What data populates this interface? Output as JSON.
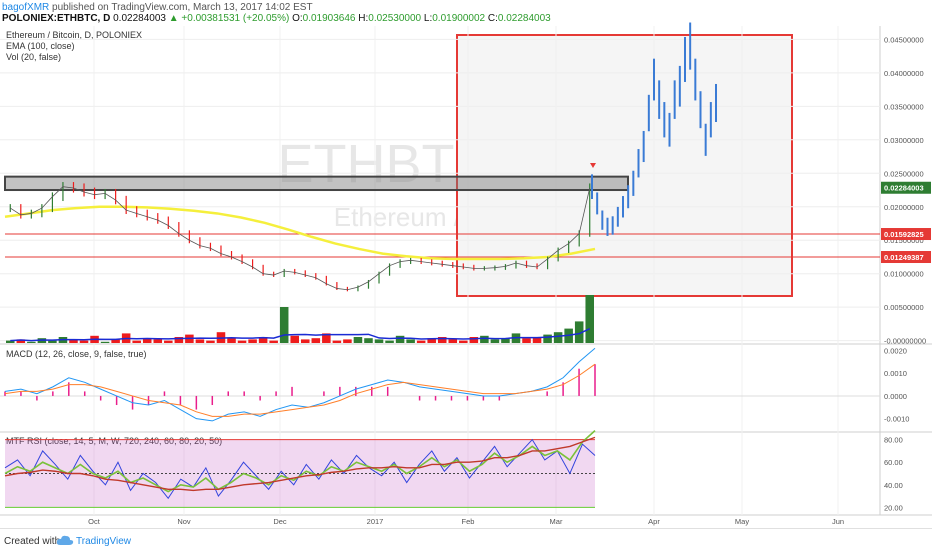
{
  "header": {
    "author": "bagofXMR",
    "published": " published on TradingView.com, March 13, 2017 14:02 EST",
    "symbol": "POLONIEX:ETHBTC, D",
    "price": "0.02284003",
    "change": "▲ +0.00381531 (+20.05%)",
    "o_label": "O:",
    "o": "0.01903646",
    "h_label": "H:",
    "h": "0.02530000",
    "l_label": "L:",
    "l": "0.01900002",
    "c_label": "C:",
    "c": "0.02284003"
  },
  "legend": {
    "series": "Ethereum / Bitcoin, D, POLONIEX",
    "ema": "EMA (100, close)",
    "vol": "Vol (20, false)",
    "macd": "MACD (12, 26, close, 9, false, true)",
    "rsi": "MTF RSI (close, 14, 5, M, W, 720, 240, 60, 80, 20, 50)"
  },
  "watermark": {
    "symbol": "ETHBTC, D",
    "name": "Ethereum / Bitcoin"
  },
  "footer": {
    "created_with": "Created with",
    "brand": "TradingView"
  },
  "colors": {
    "up": "#2e7d32",
    "down": "#ee1c1c",
    "ema": "#f5ef3c",
    "vol_ma": "#1a2bd4",
    "line_red": "#e53935",
    "projection": "#3a7bd5",
    "zone": "#444444"
  },
  "chart_data": [
    {
      "type": "line",
      "title": "Ethereum / Bitcoin, D, POLONIEX",
      "ylim": [
        -0.0005,
        0.047
      ],
      "y_ticks": [
        "0.04500000",
        "0.04000000",
        "0.03500000",
        "0.03000000",
        "0.02500000",
        "0.02000000",
        "0.01500000",
        "0.01000000",
        "0.00500000",
        "-0.00000000"
      ],
      "x_ticks": [
        "Oct",
        "Nov",
        "Dec",
        "2017",
        "Feb",
        "Mar",
        "Apr",
        "May",
        "Jun"
      ],
      "price_labels": [
        {
          "text": "0.02284003",
          "value": 0.02284,
          "color": "#2e7d32"
        },
        {
          "text": "0.01592825",
          "value": 0.015928,
          "color": "#e53935"
        },
        {
          "text": "0.01249387",
          "value": 0.012494,
          "color": "#e53935"
        }
      ],
      "horizontal_lines": [
        0.015928,
        0.012494
      ],
      "resistance_zone": [
        0.0225,
        0.0245
      ],
      "price_close": [
        0.0198,
        0.0188,
        0.019,
        0.0198,
        0.0215,
        0.023,
        0.0228,
        0.0222,
        0.0218,
        0.022,
        0.021,
        0.0195,
        0.019,
        0.0185,
        0.018,
        0.0172,
        0.016,
        0.015,
        0.0142,
        0.0138,
        0.013,
        0.0125,
        0.0118,
        0.011,
        0.01,
        0.0098,
        0.0104,
        0.0102,
        0.0098,
        0.0094,
        0.0085,
        0.0078,
        0.0076,
        0.008,
        0.0088,
        0.01,
        0.0112,
        0.0118,
        0.012,
        0.0118,
        0.0116,
        0.0114,
        0.0112,
        0.011,
        0.0108,
        0.0108,
        0.0109,
        0.0111,
        0.0116,
        0.0112,
        0.011,
        0.0122,
        0.0135,
        0.0145,
        0.016,
        0.0228
      ],
      "ema_100": [
        0.0185,
        0.019,
        0.0195,
        0.0198,
        0.02,
        0.02,
        0.0199,
        0.0197,
        0.0194,
        0.019,
        0.0184,
        0.0176,
        0.0166,
        0.0155,
        0.0145,
        0.0137,
        0.013,
        0.0126,
        0.0123,
        0.0122,
        0.0122,
        0.0122,
        0.0123,
        0.0125,
        0.013,
        0.0137
      ],
      "projected_close": [
        0.023,
        0.0205,
        0.018,
        0.017,
        0.0172,
        0.0185,
        0.02,
        0.0215,
        0.0235,
        0.0265,
        0.029,
        0.034,
        0.039,
        0.036,
        0.033,
        0.0315,
        0.036,
        0.038,
        0.042,
        0.044,
        0.039,
        0.0345,
        0.03,
        0.033,
        0.0355
      ]
    },
    {
      "type": "bar",
      "title": "Vol (20, false)",
      "values": [
        2,
        3,
        1,
        4,
        2,
        5,
        3,
        2,
        6,
        1,
        3,
        8,
        2,
        4,
        3,
        2,
        5,
        7,
        3,
        2,
        9,
        4,
        2,
        3,
        5,
        2,
        30,
        6,
        3,
        4,
        8,
        2,
        3,
        5,
        4,
        3,
        2,
        6,
        3,
        2,
        4,
        5,
        3,
        2,
        5,
        6,
        3,
        4,
        8,
        4,
        5,
        7,
        9,
        12,
        18,
        40
      ]
    },
    {
      "type": "line",
      "title": "MACD (12, 26, close, 9, false, true)",
      "y_ticks": [
        "0.0020",
        "0.0010",
        "0.0000",
        "-0.0010"
      ],
      "ylim": [
        -0.0015,
        0.0022
      ],
      "series": [
        {
          "name": "MACD",
          "values": [
            0.0002,
            0.0003,
            0.0001,
            0.0004,
            0.0008,
            0.0006,
            0.0003,
            0.0,
            -0.0003,
            -0.0004,
            -0.0002,
            -0.0006,
            -0.001,
            -0.0011,
            -0.0008,
            -0.0007,
            -0.0009,
            -0.0006,
            -0.0004,
            -0.0005,
            -0.0003,
            0.0,
            0.0003,
            0.0005,
            0.0007,
            0.0006,
            0.0004,
            0.0003,
            0.0002,
            0.0001,
            0.0,
            0.0,
            0.0001,
            0.0002,
            0.0004,
            0.0008,
            0.0015,
            0.0021
          ]
        },
        {
          "name": "Signal",
          "values": [
            0.0001,
            0.0002,
            0.0002,
            0.0003,
            0.0005,
            0.0005,
            0.0004,
            0.0002,
            0.0,
            -0.0002,
            -0.0003,
            -0.0004,
            -0.0007,
            -0.0009,
            -0.0009,
            -0.0008,
            -0.0008,
            -0.0007,
            -0.0006,
            -0.0005,
            -0.0004,
            -0.0002,
            0.0001,
            0.0003,
            0.0005,
            0.0006,
            0.0005,
            0.0004,
            0.0003,
            0.0002,
            0.0001,
            0.0001,
            0.0001,
            0.0002,
            0.0003,
            0.0005,
            0.0009,
            0.0014
          ]
        }
      ]
    },
    {
      "type": "line",
      "title": "MTF RSI (close, 14, 5, M, W, 720, 240, 60, 80, 20, 50)",
      "y_ticks": [
        "80.00",
        "60.00",
        "40.00",
        "20.00"
      ],
      "ylim": [
        15,
        85
      ],
      "bands": [
        80,
        20,
        50
      ],
      "series": [
        {
          "name": "RSI",
          "values": [
            55,
            62,
            48,
            70,
            58,
            45,
            66,
            52,
            40,
            60,
            35,
            50,
            42,
            28,
            45,
            38,
            55,
            30,
            44,
            60,
            48,
            36,
            52,
            40,
            58,
            45,
            62,
            50,
            66,
            55,
            48,
            60,
            42,
            58,
            70,
            52,
            64,
            46,
            60,
            74,
            56,
            68,
            80,
            62,
            70,
            50,
            76,
            66
          ]
        },
        {
          "name": "RSI 2",
          "values": [
            50,
            56,
            52,
            60,
            55,
            50,
            58,
            50,
            46,
            52,
            42,
            46,
            40,
            34,
            40,
            38,
            46,
            36,
            42,
            50,
            46,
            40,
            48,
            44,
            52,
            48,
            56,
            52,
            60,
            56,
            52,
            58,
            50,
            56,
            64,
            56,
            62,
            52,
            58,
            68,
            60,
            66,
            74,
            66,
            70,
            62,
            78,
            88
          ]
        },
        {
          "name": "RSI 3",
          "values": [
            48,
            50,
            51,
            53,
            52,
            50,
            50,
            48,
            45,
            44,
            42,
            40,
            38,
            36,
            36,
            35,
            36,
            36,
            38,
            40,
            41,
            42,
            44,
            46,
            48,
            49,
            51,
            52,
            54,
            55,
            55,
            56,
            55,
            55,
            58,
            58,
            60,
            60,
            61,
            64,
            64,
            66,
            70,
            70,
            72,
            74,
            78,
            82
          ]
        }
      ]
    }
  ]
}
